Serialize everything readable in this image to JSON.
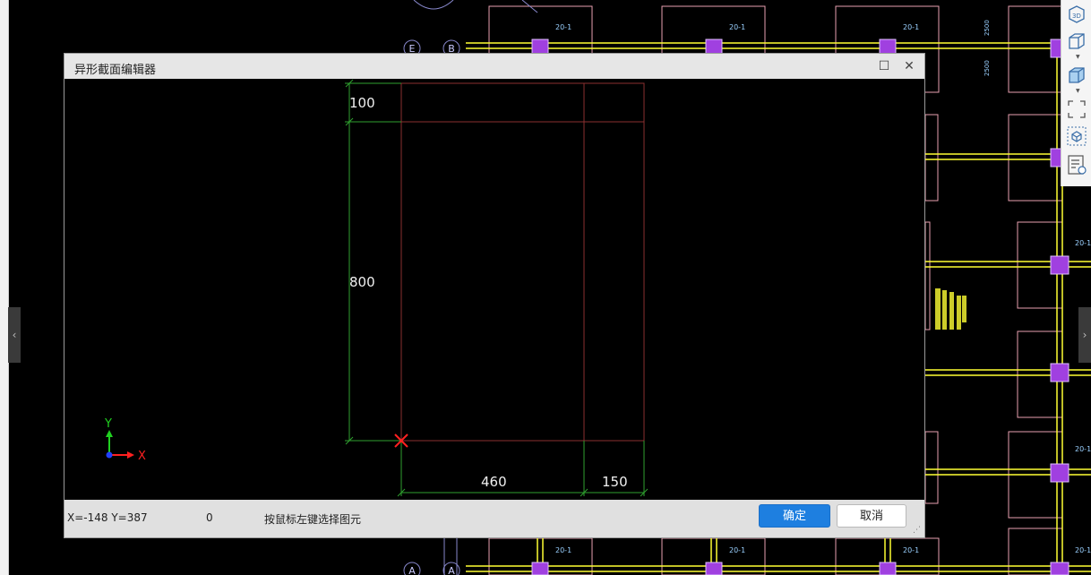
{
  "dialog": {
    "title": "异形截面编辑器",
    "maximize_glyph": "☐",
    "close_glyph": "✕"
  },
  "dimensions": {
    "top_height": "100",
    "main_height": "800",
    "bottom_left_width": "460",
    "bottom_right_width": "150"
  },
  "axes": {
    "y_label": "Y",
    "x_label": "X"
  },
  "status": {
    "coords": "X=-148 Y=387",
    "value": "0",
    "hint": "按鼠标左键选择图元"
  },
  "buttons": {
    "ok": "确定",
    "cancel": "取消"
  },
  "toolbar": {
    "items": [
      "3d-view-icon",
      "cube-icon",
      "cube-filled-icon",
      "fullscreen-icon",
      "box-view-icon",
      "properties-view-icon"
    ],
    "view_3d_label": "3D"
  },
  "background": {
    "label_20_1": "20-1",
    "grid_label_e": "E",
    "grid_label_b": "B",
    "grid_label_a": "A",
    "dim_2500": "2500"
  },
  "colors": {
    "accent": "#1e7fe0",
    "dim_green": "#2fa12f",
    "outline_red": "#8a3030",
    "cad_yellow": "#ffff33",
    "cad_pink": "#e8a0b0",
    "cad_purple": "#a040e0"
  }
}
